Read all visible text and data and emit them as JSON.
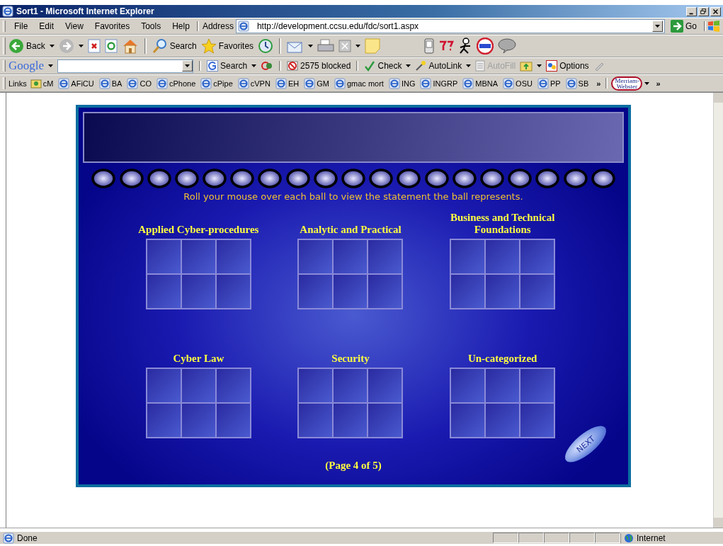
{
  "window": {
    "title": "Sort1 - Microsoft Internet Explorer"
  },
  "menu": [
    "File",
    "Edit",
    "View",
    "Favorites",
    "Tools",
    "Help"
  ],
  "address": {
    "label": "Address",
    "url": "http://development.ccsu.edu/fdc/sort1.aspx",
    "go": "Go"
  },
  "toolbar": {
    "back": "Back",
    "search": "Search",
    "favorites": "Favorites"
  },
  "google_bar": {
    "logo": "Google",
    "search": "Search",
    "blocked": "2575 blocked",
    "check": "Check",
    "autolink": "AutoLink",
    "autofill": "AutoFill",
    "autofill_disabled": true,
    "options": "Options"
  },
  "links_bar": {
    "label": "Links",
    "links": [
      {
        "label": "cM",
        "kind": "folder"
      },
      {
        "label": "AFiCU",
        "kind": "page"
      },
      {
        "label": "BA",
        "kind": "page"
      },
      {
        "label": "CO",
        "kind": "page"
      },
      {
        "label": "cPhone",
        "kind": "page"
      },
      {
        "label": "cPipe",
        "kind": "page"
      },
      {
        "label": "cVPN",
        "kind": "page"
      },
      {
        "label": "EH",
        "kind": "page"
      },
      {
        "label": "GM",
        "kind": "page"
      },
      {
        "label": "gmac mort",
        "kind": "page"
      },
      {
        "label": "ING",
        "kind": "page"
      },
      {
        "label": "INGRP",
        "kind": "page"
      },
      {
        "label": "MBNA",
        "kind": "page"
      },
      {
        "label": "OSU",
        "kind": "page"
      },
      {
        "label": "PP",
        "kind": "page"
      },
      {
        "label": "SB",
        "kind": "page"
      }
    ],
    "more": "»",
    "dictionary": "Merriam-Webster",
    "more_right": "»"
  },
  "page": {
    "instruction": "Roll your mouse over each ball to view the statement the ball represents.",
    "categories": [
      {
        "title": "Applied Cyber-procedures"
      },
      {
        "title": "Analytic and Practical"
      },
      {
        "title": "Business and Technical Foundations"
      },
      {
        "title": "Cyber Law"
      },
      {
        "title": "Security"
      },
      {
        "title": "Un-categorized"
      }
    ],
    "next": "NEXT",
    "pager": "(Page 4 of 5)"
  },
  "status_bar": {
    "text": "Done",
    "zone": "Internet"
  }
}
